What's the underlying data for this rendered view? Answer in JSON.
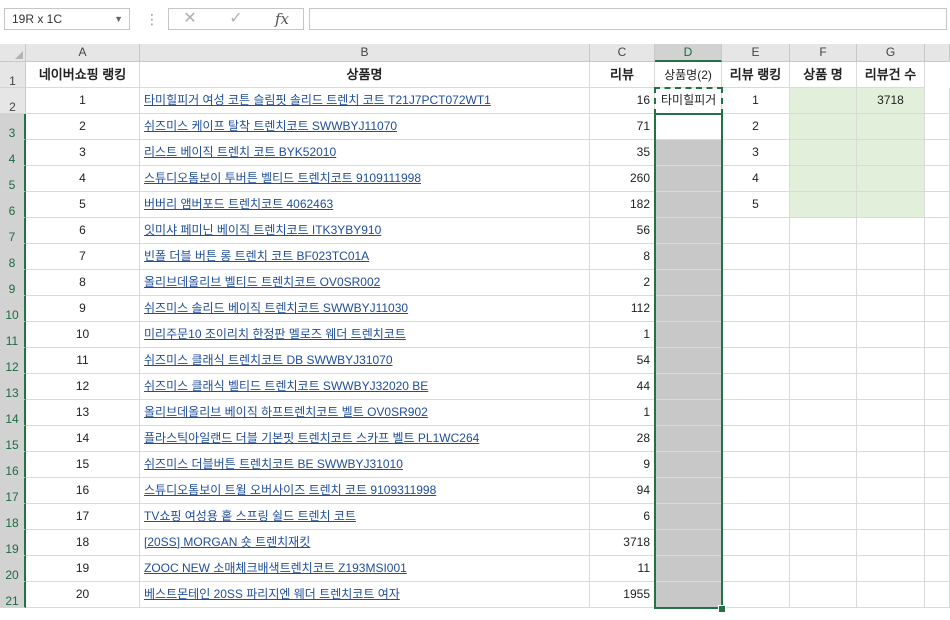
{
  "formula_bar": {
    "name_box": "19R x 1C",
    "cancel_icon": "✕",
    "enter_icon": "✓",
    "fx_label": "fx",
    "formula_value": ""
  },
  "sheet": {
    "columns": [
      "A",
      "B",
      "C",
      "D",
      "E",
      "F",
      "G"
    ],
    "row_numbers": [
      "1",
      "2",
      "3",
      "4",
      "5",
      "6",
      "7",
      "8",
      "9",
      "10",
      "11",
      "12",
      "13",
      "14",
      "15",
      "16",
      "17",
      "18",
      "19",
      "20",
      "21"
    ],
    "header_row": {
      "a": "네이버쇼핑 랭킹",
      "b": "상품명",
      "c": "리뷰",
      "d": "상품명(2)",
      "e": "리뷰 랭킹",
      "f": "상품 명",
      "g": "리뷰건 수"
    },
    "rows": [
      {
        "rank": "1",
        "name": "타미힐피거 여성 코튼 슬림핏 솔리드 트렌치 코트 T21J7PCT072WT1",
        "reviews": "16"
      },
      {
        "rank": "2",
        "name": "쉬즈미스 케이프 탈착 트렌치코트 SWWBYJ11070",
        "reviews": "71"
      },
      {
        "rank": "3",
        "name": "리스트 베이직 트렌치 코트 BYK52010",
        "reviews": "35"
      },
      {
        "rank": "4",
        "name": "스튜디오톰보이 투버튼 벨티드 트렌치코트 9109111998",
        "reviews": "260"
      },
      {
        "rank": "5",
        "name": "버버리 앰버포드 트렌치코트 4062463",
        "reviews": "182"
      },
      {
        "rank": "6",
        "name": "잇미샤 페미닌 베이직 트렌치코트 ITK3YBY910",
        "reviews": "56"
      },
      {
        "rank": "7",
        "name": "빈폴 더블 버튼 롱 트렌치 코트 BF023TC01A",
        "reviews": "8"
      },
      {
        "rank": "8",
        "name": "올리브데올리브 벨티드 트렌치코트 OV0SR002",
        "reviews": "2"
      },
      {
        "rank": "9",
        "name": "쉬즈미스 솔리드 베이직 트렌치코트 SWWBYJ11030",
        "reviews": "112"
      },
      {
        "rank": "10",
        "name": "미리주문10 조이리치 한정판 멜로즈 웨더 트렌치코트",
        "reviews": "1"
      },
      {
        "rank": "11",
        "name": "쉬즈미스 클래식 트렌치코트 DB SWWBYJ31070",
        "reviews": "54"
      },
      {
        "rank": "12",
        "name": "쉬즈미스 클래식 벨티드 트렌치코트 SWWBYJ32020 BE",
        "reviews": "44"
      },
      {
        "rank": "13",
        "name": "올리브데올리브 베이직 하프트렌치코트 벨트 OV0SR902",
        "reviews": "1"
      },
      {
        "rank": "14",
        "name": "플라스틱아일랜드 더블 기본핏 트렌치코트 스카프 벨트 PL1WC264",
        "reviews": "28"
      },
      {
        "rank": "15",
        "name": "쉬즈미스 더블버튼 트렌치코트 BE SWWBYJ31010",
        "reviews": "9"
      },
      {
        "rank": "16",
        "name": "스튜디오톰보이 트윌 오버사이즈 트렌치 코트 9109311998",
        "reviews": "94"
      },
      {
        "rank": "17",
        "name": "TV쇼핑 여성용 홑 스프링 쉴드 트렌치 코트",
        "reviews": "6"
      },
      {
        "rank": "18",
        "name": "[20SS] MORGAN 숏 트렌치재킷",
        "reviews": "3718"
      },
      {
        "rank": "19",
        "name": "ZOOC NEW 소매체크배색트렌치코트 Z193MSI001",
        "reviews": "11"
      },
      {
        "rank": "20",
        "name": "베스트몬테인 20SS 파리지엔 웨더 트렌치코트 여자",
        "reviews": "1955"
      }
    ],
    "d2_value": "타미힐피거",
    "review_rank": [
      "1",
      "2",
      "3",
      "4",
      "5"
    ],
    "g2_value": "3718"
  }
}
